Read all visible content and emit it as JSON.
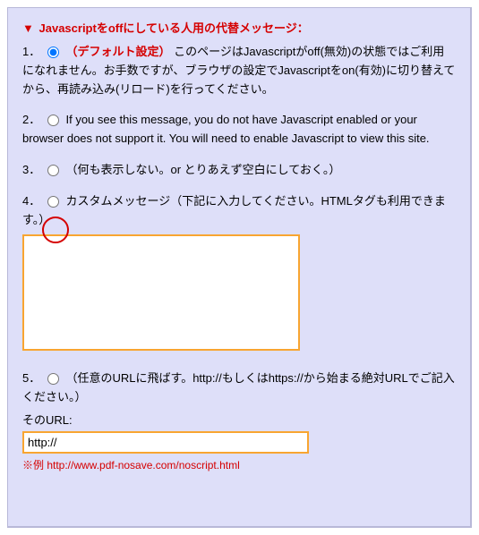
{
  "section": {
    "marker": "▼",
    "title": "Javascriptをoffにしている人用の代替メッセージ："
  },
  "options": {
    "o1": {
      "num": "1．",
      "tag": "（デフォルト設定）",
      "text": "このページはJavascriptがoff(無効)の状態ではご利用になれません。お手数ですが、ブラウザの設定でJavascriptをon(有効)に切り替えてから、再読み込み(リロード)を行ってください。"
    },
    "o2": {
      "num": "2．",
      "text": "If you see this message, you do not have Javascript enabled or your browser does not support it. You will need to enable Javascript to view this site."
    },
    "o3": {
      "num": "3．",
      "text": "（何も表示しない。or とりあえず空白にしておく。）"
    },
    "o4": {
      "num": "4．",
      "text": "カスタムメッセージ（下記に入力してください。HTMLタグも利用できます。）",
      "textarea_value": ""
    },
    "o5": {
      "num": "5．",
      "text": "（任意のURLに飛ばす。http://もしくはhttps://から始まる絶対URLでご記入ください。）",
      "url_label": "そのURL:",
      "url_value": "http://",
      "example": "※例 http://www.pdf-nosave.com/noscript.html"
    }
  }
}
